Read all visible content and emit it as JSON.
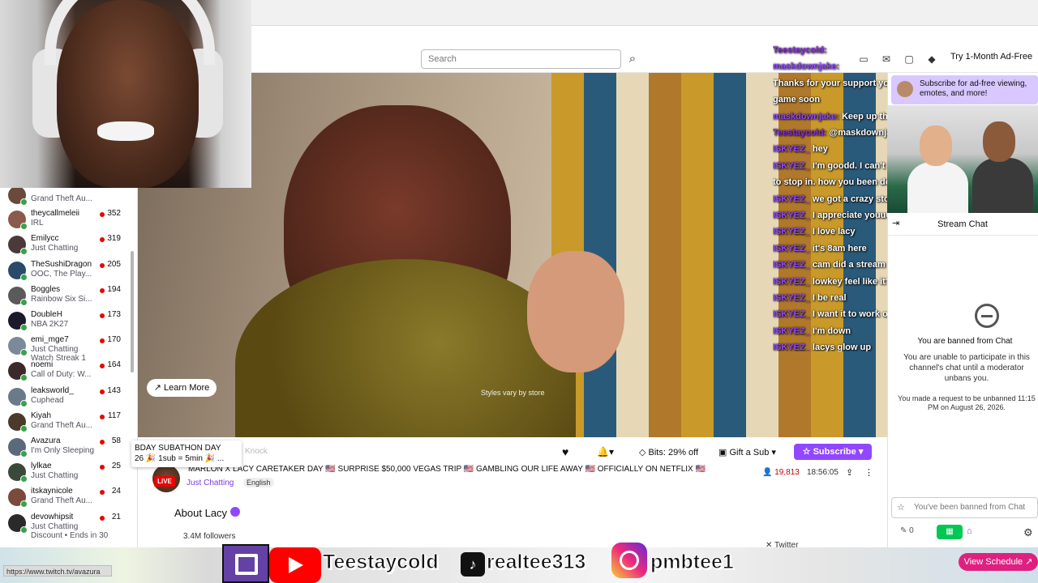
{
  "browser": {
    "url_status": "https://www.twitch.tv/avazura"
  },
  "topbar": {
    "search_placeholder": "Search",
    "ad_free": "Try 1-Month Ad-Free"
  },
  "sidebar": {
    "channels": [
      {
        "name": "",
        "game": "Grand Theft Au...",
        "viewers": "",
        "extra": "",
        "avatar": "#6a4a3a"
      },
      {
        "name": "theycallmeleii",
        "game": "IRL",
        "viewers": "352",
        "extra": "",
        "avatar": "#8a5a4a"
      },
      {
        "name": "Emilycc",
        "game": "Just Chatting",
        "viewers": "319",
        "extra": "",
        "avatar": "#4a3a3a"
      },
      {
        "name": "TheSushiDragon",
        "game": "OOC, The Play...",
        "viewers": "205",
        "extra": "",
        "avatar": "#2a4a6a"
      },
      {
        "name": "Boggles",
        "game": "Rainbow Six Si...",
        "viewers": "194",
        "extra": "",
        "avatar": "#5a5a5a"
      },
      {
        "name": "DoubleH",
        "game": "NBA 2K27",
        "viewers": "173",
        "extra": "",
        "avatar": "#1a1a2a"
      },
      {
        "name": "emi_mge7",
        "game": "Just Chatting",
        "viewers": "170",
        "extra": "Watch Streak 1",
        "avatar": "#7a8a9a"
      },
      {
        "name": "noemi",
        "game": "Call of Duty: W...",
        "viewers": "164",
        "extra": "",
        "avatar": "#3a2a2a"
      },
      {
        "name": "leaksworld_",
        "game": "Cuphead",
        "viewers": "143",
        "extra": "",
        "avatar": "#6a7a8a"
      },
      {
        "name": "Kiyah",
        "game": "Grand Theft Au...",
        "viewers": "117",
        "extra": "",
        "avatar": "#4a3a2a"
      },
      {
        "name": "Avazura",
        "game": "I'm Only Sleeping",
        "viewers": "58",
        "extra": "",
        "avatar": "#5a6a7a"
      },
      {
        "name": "lylkae",
        "game": "Just Chatting",
        "viewers": "25",
        "extra": "",
        "avatar": "#3a4a3a"
      },
      {
        "name": "itskaynicole",
        "game": "Grand Theft Au...",
        "viewers": "24",
        "extra": "",
        "avatar": "#7a4a3a"
      },
      {
        "name": "devowhipsit",
        "game": "Just Chatting",
        "viewers": "21",
        "extra": "Discount • Ends in 30",
        "avatar": "#2a2a2a"
      }
    ]
  },
  "video": {
    "learn_more": "Learn More",
    "disclaimer": "Styles vary by store"
  },
  "chat_overlay": [
    {
      "user": "Teestaycold:",
      "msg": "",
      "uc": "u"
    },
    {
      "user": "maskdownjake:",
      "msg": "",
      "uc": "g"
    },
    {
      "user": "",
      "msg": "Thanks for your support you been around for a min. We'll",
      "uc": "u"
    },
    {
      "user": "",
      "msg": "game soon",
      "uc": "u"
    },
    {
      "user": "maskdownjake:",
      "msg": "Keep up the grind !!!",
      "uc": "g"
    },
    {
      "user": "Teestaycold:",
      "msg": "@maskdownjake WWW JAKE",
      "uc": "u"
    },
    {
      "user": "ISKYEZ_",
      "msg": "hey",
      "uc": "g"
    },
    {
      "user": "ISKYEZ_",
      "msg": "I'm goodd. I can't stay long today, but wanted",
      "uc": "g"
    },
    {
      "user": "",
      "msg": "to stop in. how you been doing",
      "uc": "g"
    },
    {
      "user": "ISKYEZ_",
      "msg": "we got a crazy storm here",
      "uc": "g"
    },
    {
      "user": "ISKYEZ_",
      "msg": "I appreciate youuu",
      "uc": "g"
    },
    {
      "user": "ISKYEZ_",
      "msg": "I love lacy",
      "uc": "g"
    },
    {
      "user": "ISKYEZ_",
      "msg": "it's 8am here",
      "uc": "g"
    },
    {
      "user": "ISKYEZ_",
      "msg": "cam did a stream w mowd",
      "uc": "g"
    },
    {
      "user": "ISKYEZ_",
      "msg": "lowkey feel like it's going in his head like",
      "uc": "g"
    },
    {
      "user": "ISKYEZ_",
      "msg": "I be real",
      "uc": "g"
    },
    {
      "user": "ISKYEZ_",
      "msg": "I want it to work out for him so bad",
      "uc": "g"
    },
    {
      "user": "ISKYEZ_",
      "msg": "I'm down",
      "uc": "g"
    },
    {
      "user": "ISKYEZ_",
      "msg": "lacys glow up",
      "uc": "g"
    }
  ],
  "right_chat": {
    "promo": "Subscribe for ad-free viewing, emotes, and more!",
    "header": "Stream Chat",
    "ban_title": "You are banned from Chat",
    "ban_desc": "You are unable to participate in this channel's chat until a moderator unbans you.",
    "ban_request": "You made a request to be unbanned 11:15 PM on August 26, 2026.",
    "input_placeholder": "You've been banned from Chat",
    "points": "0"
  },
  "stream": {
    "knock": "Knock",
    "bday": "BDAY SUBATHON DAY",
    "bday_sub": "26 🎉 1sub = 5min 🎉 ...",
    "bits": "Bits: 29% off",
    "gift": "Gift a Sub",
    "subscribe": "Subscribe",
    "live": "LIVE",
    "title": "MARLON X LACY CARETAKER DAY 🇺🇸 SURPRISE $50,000 VEGAS TRIP 🇺🇸 GAMBLING OUR LIFE AWAY 🇺🇸 OFFICIALLY ON NETFLIX 🇺🇸",
    "category": "Just Chatting",
    "language": "English",
    "viewers": "19,813",
    "uptime": "18:56:05",
    "about": "About Lacy",
    "followers": "3.4M followers",
    "twitter": "Twitter"
  },
  "banner": {
    "youtube_handle": "Teestaycold",
    "tiktok_handle": "realtee313",
    "instagram_handle": "pmbtee1",
    "schedule": "View Schedule"
  }
}
